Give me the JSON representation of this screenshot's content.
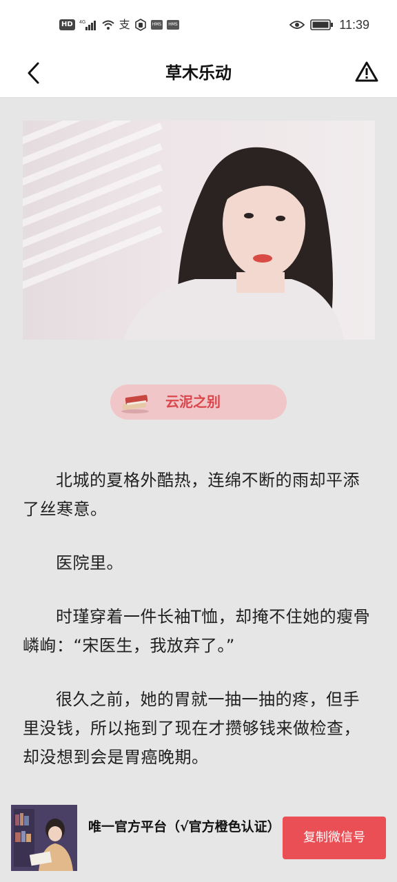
{
  "status_bar": {
    "time": "11:39",
    "badges": [
      "HD",
      "4G",
      "HMS",
      "HMS"
    ],
    "icons": [
      "signal-icon",
      "wifi-icon",
      "alipay-icon",
      "hand-icon",
      "eye-icon",
      "battery-icon"
    ]
  },
  "nav": {
    "title": "草木乐动",
    "back_icon": "chevron-left-icon",
    "warn_icon": "warning-icon"
  },
  "chapter": {
    "icon": "book-icon",
    "label": "云泥之别"
  },
  "story": {
    "paragraphs": [
      "北城的夏格外酷热，连绵不断的雨却平添了丝寒意。",
      "医院里。",
      "时瑾穿着一件长袖T恤，却掩不住她的瘦骨嶙峋：“宋医生，我放弃了。”",
      "很久之前，她的胃就一抽一抽的疼，但手里没钱，所以拖到了现在才攒够钱来做检查，却没想到会是胃癌晚期。"
    ]
  },
  "promo": {
    "text": "唯一官方平台（√官方橙色认证）",
    "button_label": "复制微信号"
  },
  "colors": {
    "accent": "#e94f55",
    "pill_bg": "#f0c6c9",
    "pill_text": "#d9474c",
    "page_bg": "#e6e6e6"
  }
}
